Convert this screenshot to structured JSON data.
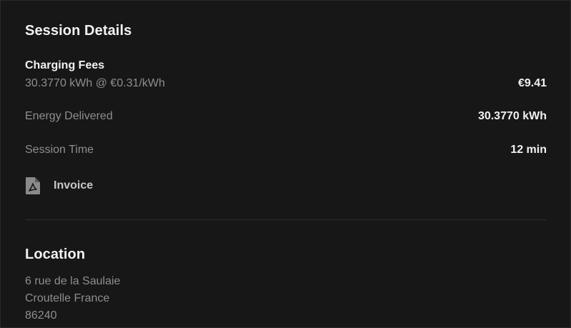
{
  "session": {
    "title": "Session Details",
    "fees": {
      "title": "Charging Fees",
      "detail": "30.3770 kWh @ €0.31/kWh",
      "amount": "€9.41"
    },
    "energy": {
      "label": "Energy Delivered",
      "value": "30.3770 kWh"
    },
    "time": {
      "label": "Session Time",
      "value": "12 min"
    },
    "invoice": {
      "icon": "pdf-file-icon",
      "label": "Invoice"
    }
  },
  "location": {
    "title": "Location",
    "address_lines": [
      "6 rue de la Saulaie",
      "Croutelle France",
      "86240"
    ]
  },
  "colors": {
    "background": "#171718",
    "primary_text": "#f2f2f2",
    "secondary_text": "#8e8e90",
    "divider": "#2f2f31"
  }
}
